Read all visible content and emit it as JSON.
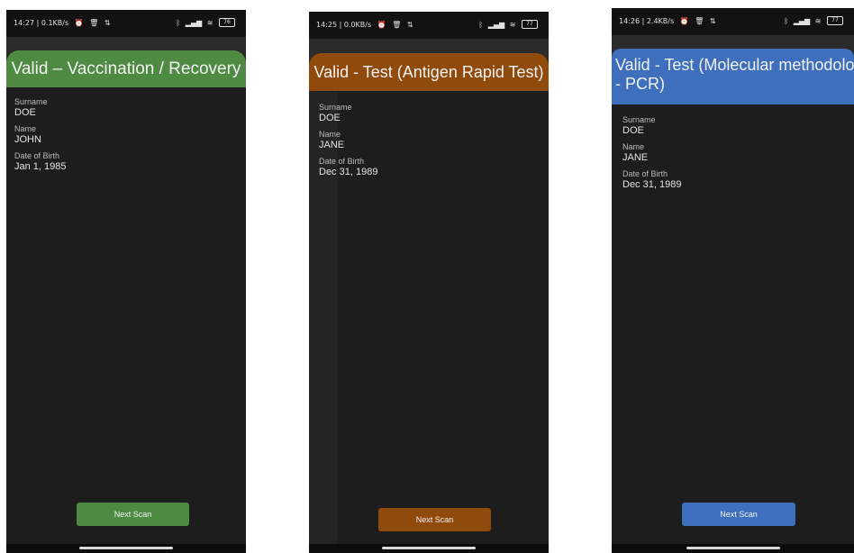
{
  "screens": [
    {
      "status": {
        "time_data": "14:27 | 0.1KB/s",
        "battery": "76"
      },
      "banner": {
        "title": "Valid – Vaccination / Recovery",
        "color": "#4f8a42"
      },
      "fields": [
        {
          "label": "Surname",
          "value": "DOE"
        },
        {
          "label": "Name",
          "value": "JOHN"
        },
        {
          "label": "Date of Birth",
          "value": "Jan 1, 1985"
        }
      ],
      "button": {
        "label": "Next Scan"
      }
    },
    {
      "status": {
        "time_data": "14:25 | 0.0KB/s",
        "battery": "77"
      },
      "banner": {
        "title": "Valid - Test (Antigen Rapid Test)",
        "color": "#904a0c"
      },
      "fields": [
        {
          "label": "Surname",
          "value": "DOE"
        },
        {
          "label": "Name",
          "value": "JANE"
        },
        {
          "label": "Date of Birth",
          "value": "Dec 31, 1989"
        }
      ],
      "button": {
        "label": "Next Scan"
      }
    },
    {
      "status": {
        "time_data": "14:26 | 2.4KB/s",
        "battery": "77"
      },
      "banner": {
        "title": "Valid - Test (Molecular methodology",
        "title_line2": "- PCR)",
        "color": "#3d6fbd"
      },
      "fields": [
        {
          "label": "Surname",
          "value": "DOE"
        },
        {
          "label": "Name",
          "value": "JANE"
        },
        {
          "label": "Date of Birth",
          "value": "Dec 31, 1989"
        }
      ],
      "button": {
        "label": "Next Scan"
      }
    }
  ],
  "icons": {
    "status_left": [
      "alarm-icon",
      "trash-icon",
      "signal-arrows-icon"
    ],
    "status_right": [
      "bluetooth-icon",
      "cell-signal-icon",
      "wifi-icon",
      "battery-icon"
    ]
  }
}
